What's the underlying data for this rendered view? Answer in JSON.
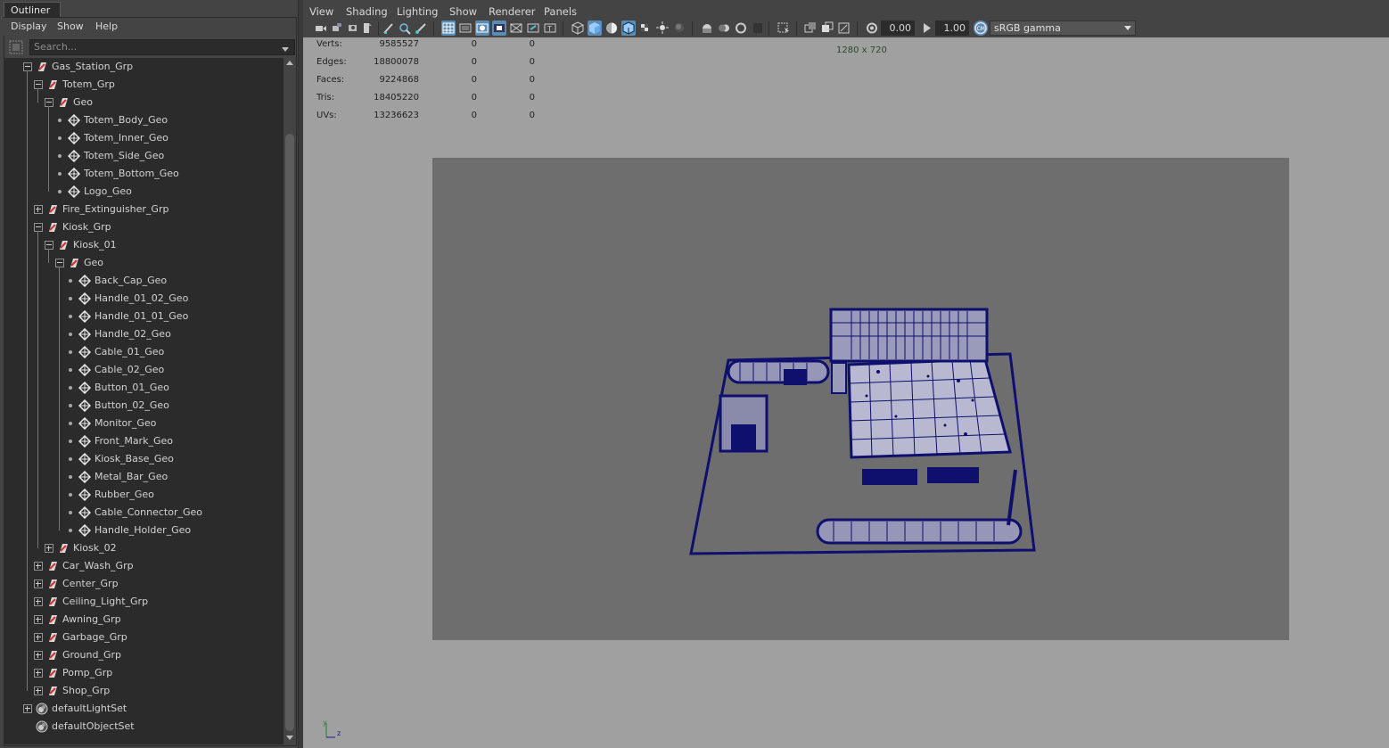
{
  "outliner": {
    "tab_label": "Outliner",
    "menus": [
      "Display",
      "Show",
      "Help"
    ],
    "search_placeholder": "Search...",
    "tree": [
      {
        "label": "Gas_Station_Grp",
        "depth": 1,
        "type": "group",
        "expander": "minus"
      },
      {
        "label": "Totem_Grp",
        "depth": 2,
        "type": "group",
        "expander": "minus"
      },
      {
        "label": "Geo",
        "depth": 3,
        "type": "group",
        "expander": "minus"
      },
      {
        "label": "Totem_Body_Geo",
        "depth": 4,
        "type": "mesh"
      },
      {
        "label": "Totem_Inner_Geo",
        "depth": 4,
        "type": "mesh"
      },
      {
        "label": "Totem_Side_Geo",
        "depth": 4,
        "type": "mesh"
      },
      {
        "label": "Totem_Bottom_Geo",
        "depth": 4,
        "type": "mesh"
      },
      {
        "label": "Logo_Geo",
        "depth": 4,
        "type": "mesh"
      },
      {
        "label": "Fire_Extinguisher_Grp",
        "depth": 2,
        "type": "group",
        "expander": "plus"
      },
      {
        "label": "Kiosk_Grp",
        "depth": 2,
        "type": "group",
        "expander": "minus"
      },
      {
        "label": "Kiosk_01",
        "depth": 3,
        "type": "group",
        "expander": "minus"
      },
      {
        "label": "Geo",
        "depth": 4,
        "type": "group",
        "expander": "minus"
      },
      {
        "label": "Back_Cap_Geo",
        "depth": 5,
        "type": "mesh"
      },
      {
        "label": "Handle_01_02_Geo",
        "depth": 5,
        "type": "mesh"
      },
      {
        "label": "Handle_01_01_Geo",
        "depth": 5,
        "type": "mesh"
      },
      {
        "label": "Handle_02_Geo",
        "depth": 5,
        "type": "mesh"
      },
      {
        "label": "Cable_01_Geo",
        "depth": 5,
        "type": "mesh"
      },
      {
        "label": "Cable_02_Geo",
        "depth": 5,
        "type": "mesh"
      },
      {
        "label": "Button_01_Geo",
        "depth": 5,
        "type": "mesh"
      },
      {
        "label": "Button_02_Geo",
        "depth": 5,
        "type": "mesh"
      },
      {
        "label": "Monitor_Geo",
        "depth": 5,
        "type": "mesh"
      },
      {
        "label": "Front_Mark_Geo",
        "depth": 5,
        "type": "mesh"
      },
      {
        "label": "Kiosk_Base_Geo",
        "depth": 5,
        "type": "mesh"
      },
      {
        "label": "Metal_Bar_Geo",
        "depth": 5,
        "type": "mesh"
      },
      {
        "label": "Rubber_Geo",
        "depth": 5,
        "type": "mesh"
      },
      {
        "label": "Cable_Connector_Geo",
        "depth": 5,
        "type": "mesh"
      },
      {
        "label": "Handle_Holder_Geo",
        "depth": 5,
        "type": "mesh"
      },
      {
        "label": "Kiosk_02",
        "depth": 3,
        "type": "group",
        "expander": "plus"
      },
      {
        "label": "Car_Wash_Grp",
        "depth": 2,
        "type": "group",
        "expander": "plus"
      },
      {
        "label": "Center_Grp",
        "depth": 2,
        "type": "group",
        "expander": "plus"
      },
      {
        "label": "Ceiling_Light_Grp",
        "depth": 2,
        "type": "group",
        "expander": "plus"
      },
      {
        "label": "Awning_Grp",
        "depth": 2,
        "type": "group",
        "expander": "plus"
      },
      {
        "label": "Garbage_Grp",
        "depth": 2,
        "type": "group",
        "expander": "plus"
      },
      {
        "label": "Ground_Grp",
        "depth": 2,
        "type": "group",
        "expander": "plus"
      },
      {
        "label": "Pomp_Grp",
        "depth": 2,
        "type": "group",
        "expander": "plus"
      },
      {
        "label": "Shop_Grp",
        "depth": 2,
        "type": "group",
        "expander": "plus"
      },
      {
        "label": "defaultLightSet",
        "depth": 1,
        "type": "set",
        "expander": "plus"
      },
      {
        "label": "defaultObjectSet",
        "depth": 1,
        "type": "set"
      }
    ]
  },
  "viewport": {
    "menus": [
      "View",
      "Shading",
      "Lighting",
      "Show",
      "Renderer",
      "Panels"
    ],
    "exposure_value": "0.00",
    "gamma_value": "1.00",
    "color_space": "sRGB gamma",
    "resolution_label": "1280 x 720",
    "hud": [
      {
        "label": "Verts:",
        "total": "9585527",
        "selected": "0",
        "components": "0"
      },
      {
        "label": "Edges:",
        "total": "18800078",
        "selected": "0",
        "components": "0"
      },
      {
        "label": "Faces:",
        "total": "9224868",
        "selected": "0",
        "components": "0"
      },
      {
        "label": "Tris:",
        "total": "18405220",
        "selected": "0",
        "components": "0"
      },
      {
        "label": "UVs:",
        "total": "13236623",
        "selected": "0",
        "components": "0"
      }
    ],
    "axis_y": "y",
    "axis_z": "z"
  },
  "colors": {
    "wireframe": "#0f0f6e",
    "resolution_gate": "#6e6e6e",
    "viewport_bg": "#a0a0a0",
    "toolbar_active": "#5b8cb4"
  }
}
